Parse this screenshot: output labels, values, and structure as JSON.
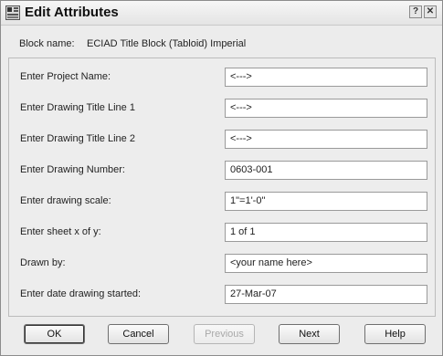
{
  "window": {
    "title": "Edit Attributes",
    "help_glyph": "?",
    "close_glyph": "✕"
  },
  "block": {
    "label": "Block name:",
    "value": "ECIAD Title Block (Tabloid) Imperial"
  },
  "attributes": [
    {
      "prompt": "Enter Project Name:",
      "value": "<--->"
    },
    {
      "prompt": "Enter Drawing Title Line 1",
      "value": "<--->"
    },
    {
      "prompt": "Enter Drawing Title Line 2",
      "value": "<--->"
    },
    {
      "prompt": "Enter Drawing Number:",
      "value": "0603-001"
    },
    {
      "prompt": "Enter drawing scale:",
      "value": "1\"=1'-0\""
    },
    {
      "prompt": "Enter sheet x of y:",
      "value": "1 of 1"
    },
    {
      "prompt": "Drawn by:",
      "value": "<your name here>"
    },
    {
      "prompt": "Enter date drawing started:",
      "value": "27-Mar-07"
    }
  ],
  "buttons": {
    "ok": "OK",
    "cancel": "Cancel",
    "previous": "Previous",
    "next": "Next",
    "help": "Help"
  }
}
